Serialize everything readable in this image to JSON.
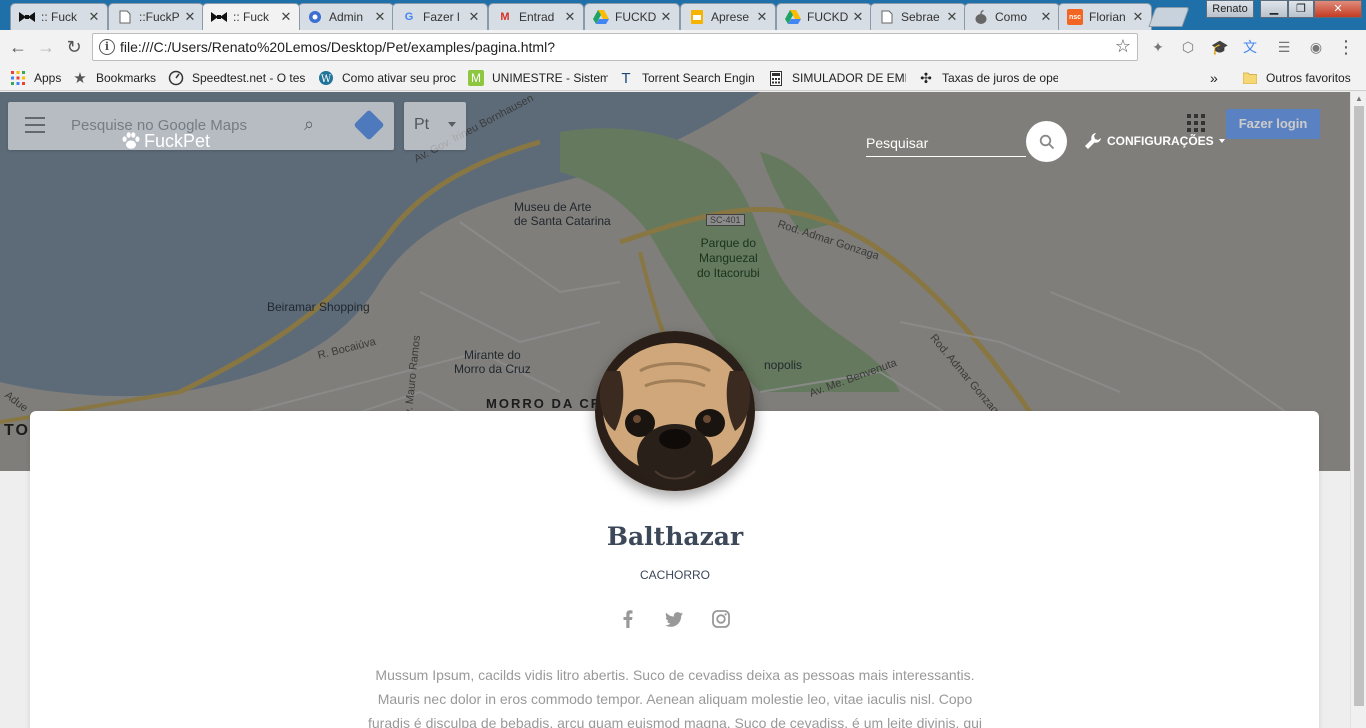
{
  "tabs": [
    {
      "label": ":: Fuck",
      "favicon": "bowtie-icon"
    },
    {
      "label": "::FuckP",
      "favicon": "page-icon"
    },
    {
      "label": ":: Fuck",
      "favicon": "bowtie-icon",
      "active": true
    },
    {
      "label": "Admin",
      "favicon": "gear-badge-icon"
    },
    {
      "label": "Fazer l",
      "favicon": "google-icon"
    },
    {
      "label": "Entrad",
      "favicon": "gmail-icon"
    },
    {
      "label": "FUCKD",
      "favicon": "drive-icon"
    },
    {
      "label": "Aprese",
      "favicon": "slides-icon"
    },
    {
      "label": "FUCKD",
      "favicon": "drive-icon"
    },
    {
      "label": "Sebrae",
      "favicon": "page-icon"
    },
    {
      "label": "Como",
      "favicon": "apple-icon"
    },
    {
      "label": "Florian",
      "favicon": "nsc-icon"
    }
  ],
  "window": {
    "user": "Renato"
  },
  "address_bar": {
    "url": "file:///C:/Users/Renato%20Lemos/Desktop/Pet/examples/pagina.html?"
  },
  "bookmarks": [
    {
      "label": "Apps",
      "icon": "apps-grid-icon"
    },
    {
      "label": "Bookmarks",
      "icon": "star-icon"
    },
    {
      "label": "Speedtest.net - O tes",
      "icon": "speedometer-icon"
    },
    {
      "label": "Como ativar seu proc",
      "icon": "wordpress-icon"
    },
    {
      "label": "UNIMESTRE - Sistema",
      "icon": "unimestre-icon"
    },
    {
      "label": "Torrent Search Engin",
      "icon": "torrent-icon"
    },
    {
      "label": "SIMULADOR DE EMP",
      "icon": "calculator-icon"
    },
    {
      "label": "Taxas de juros de ope",
      "icon": "bank-icon"
    }
  ],
  "bookmarks_overflow": "»",
  "other_bookmarks": "Outros favoritos",
  "map": {
    "search_placeholder": "Pesquise no Google Maps",
    "language": "Pt",
    "login": "Fazer login",
    "labels": {
      "museum": "Museu de Arte\nde Santa Catarina",
      "park": "Parque do\nManguezal\ndo Itacorubi",
      "mall": "Beiramar Shopping",
      "mirante": "Mirante do\nMorro da Cruz",
      "morro": "MORRO DA CRUZ",
      "road1": "Av. Gov. Irineu Bornhausen",
      "road2": "Rod. Admar Gonzaga",
      "road3": "Rod. Admar Gonzaga",
      "road4": "R. Bocaiúva",
      "road5": "Av. Me. Benvenuta",
      "road6": "SC-401",
      "road7": "nopolis",
      "road8": "TO",
      "road9": "Av. Mauro Ramos",
      "road10": "Adue"
    }
  },
  "page": {
    "brand": "FuckPet",
    "search_placeholder": "Pesquisar",
    "settings": "CONFIGURAÇÕES"
  },
  "profile": {
    "name": "Balthazar",
    "type": "CACHORRO",
    "description": "Mussum Ipsum, cacilds vidis litro abertis. Suco de cevadiss deixa as pessoas mais interessantis. Mauris nec dolor in eros commodo tempor. Aenean aliquam molestie leo, vitae iaculis nisl. Copo furadis é disculpa de bebadis, arcu quam euismod magna. Suco de cevadiss, é um leite divinis, qui"
  },
  "colors": {
    "brand_blue": "#4285f4",
    "title": "#3c4858",
    "muted": "#999999"
  }
}
